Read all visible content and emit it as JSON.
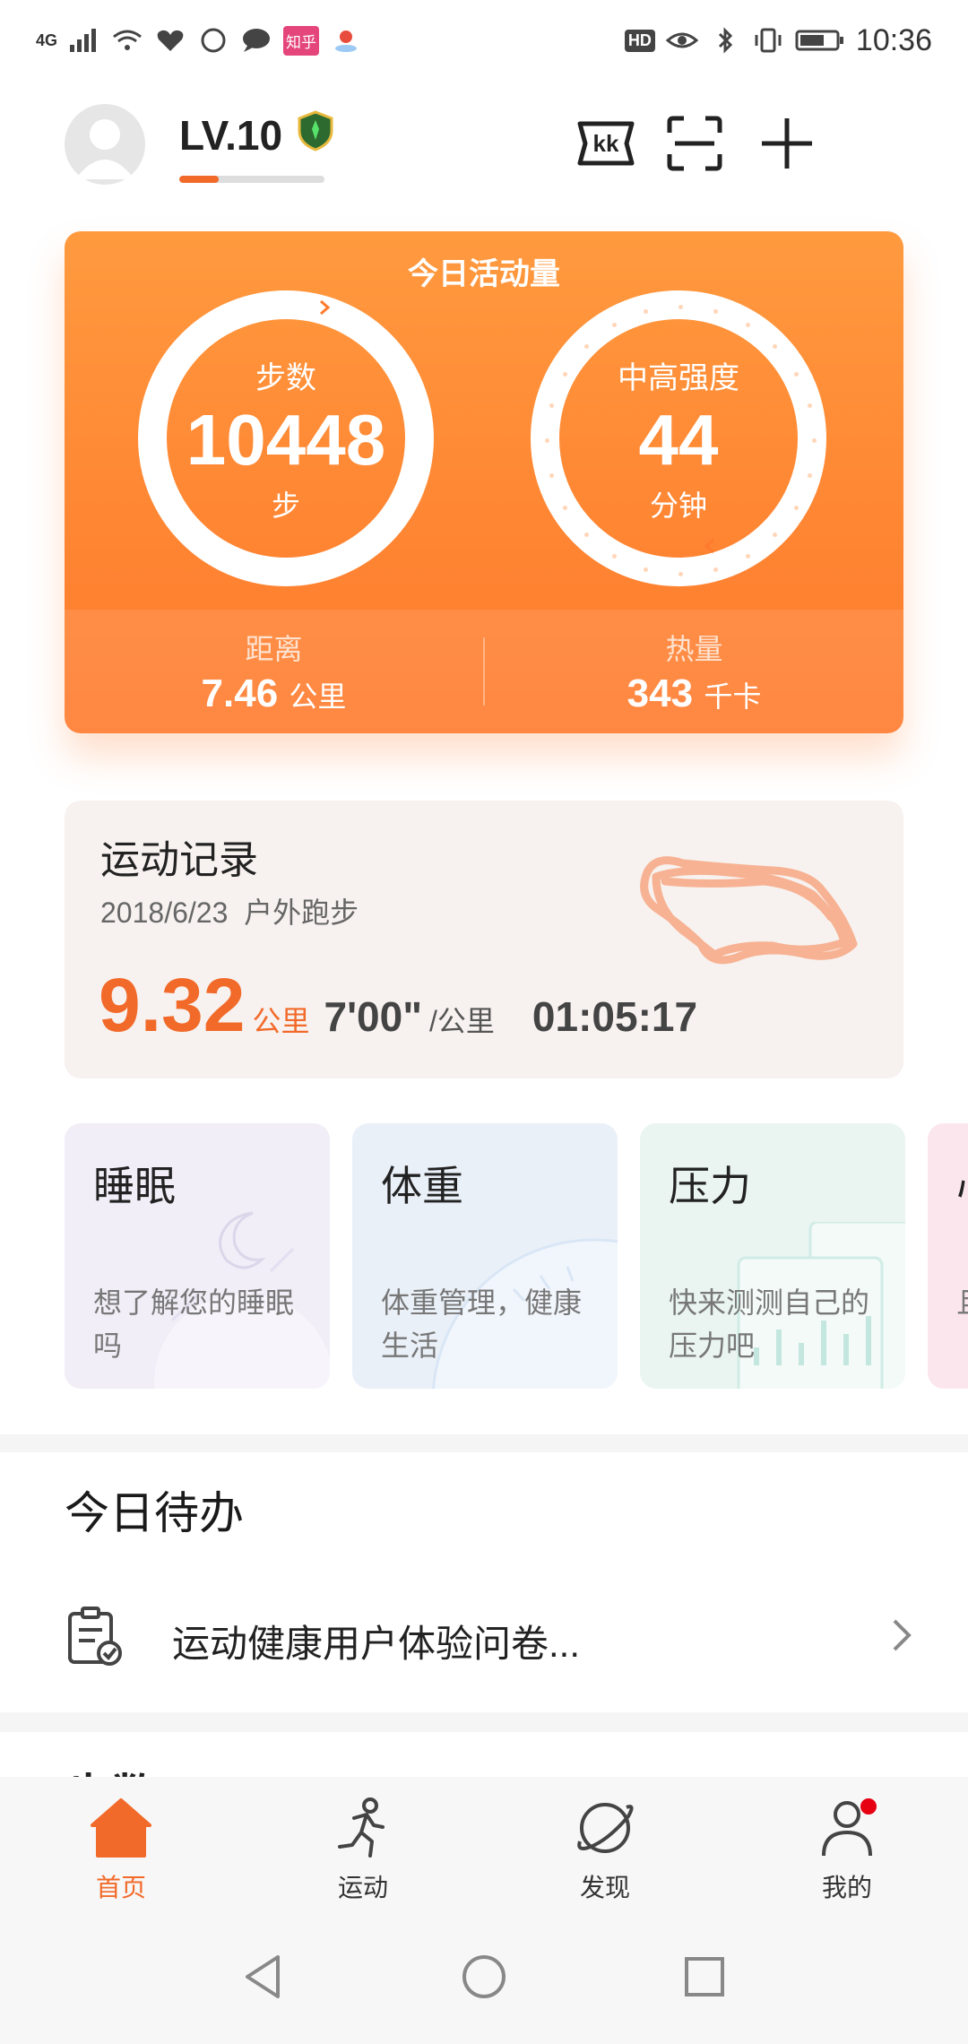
{
  "status_bar": {
    "network": "4G",
    "time": "10:36",
    "hd": "HD",
    "app_badge": "知乎"
  },
  "header": {
    "level": "LV.10",
    "level_progress": 0.27
  },
  "activity": {
    "title": "今日活动量",
    "steps": {
      "label": "步数",
      "value": "10448",
      "unit": "步"
    },
    "intensity": {
      "label": "中高强度",
      "value": "44",
      "unit": "分钟"
    },
    "distance": {
      "label": "距离",
      "value": "7.46",
      "unit": "公里"
    },
    "calories": {
      "label": "热量",
      "value": "343",
      "unit": "千卡"
    }
  },
  "record": {
    "title": "运动记录",
    "date": "2018/6/23",
    "type": "户外跑步",
    "distance": "9.32",
    "distance_unit": "公里",
    "pace": "7'00\"",
    "pace_unit": "/公里",
    "duration": "01:05:17"
  },
  "tiles": [
    {
      "title": "睡眠",
      "desc": "想了解您的睡眠吗"
    },
    {
      "title": "体重",
      "desc": "体重管理，健康生活"
    },
    {
      "title": "压力",
      "desc": "快来测测自己的压力吧"
    },
    {
      "title": "心",
      "desc": "且看"
    }
  ],
  "todo": {
    "title": "今日待办",
    "item": "运动健康用户体验问卷..."
  },
  "next_section": "步数",
  "nav": [
    {
      "label": "首页",
      "icon": "home-icon"
    },
    {
      "label": "运动",
      "icon": "running-icon"
    },
    {
      "label": "发现",
      "icon": "planet-icon"
    },
    {
      "label": "我的",
      "icon": "person-icon"
    }
  ],
  "colors": {
    "accent": "#f26a2a",
    "card_orange": "#ff8a35",
    "notify": "#e60012"
  }
}
